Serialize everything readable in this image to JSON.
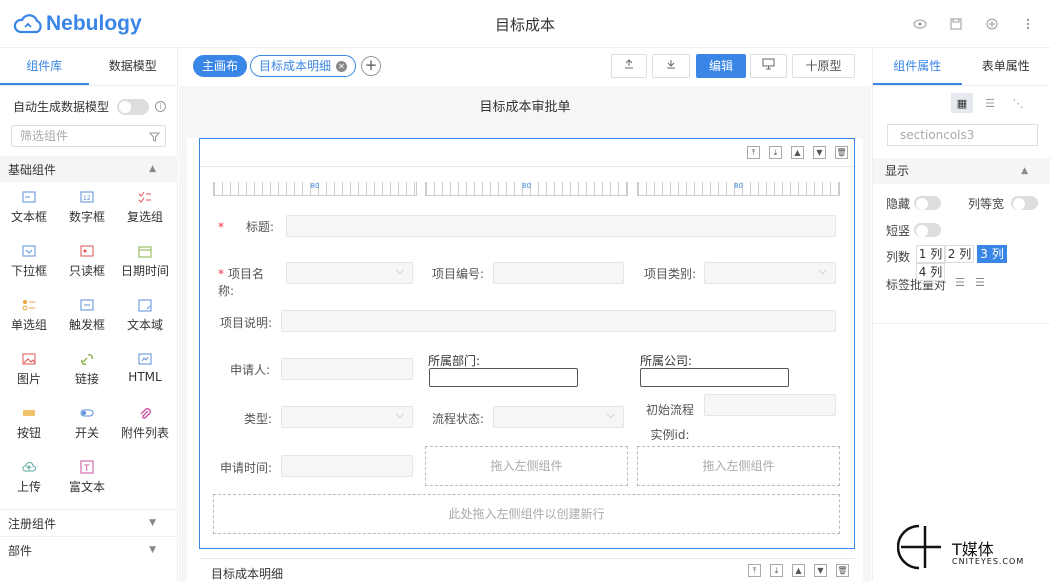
{
  "app": {
    "logo": "Nebulogy",
    "title": "目标成本"
  },
  "left": {
    "tabs": [
      "组件库",
      "数据模型"
    ],
    "auto_model": "自动生成数据模型",
    "filter_placeholder": "筛选组件",
    "basic_section": "基础组件",
    "components": [
      "文本框",
      "数字框",
      "复选组",
      "下拉框",
      "只读框",
      "日期时间",
      "单选组",
      "触发框",
      "文本域",
      "图片",
      "链接",
      "HTML",
      "按钮",
      "开关",
      "附件列表",
      "上传",
      "富文本"
    ],
    "other_sections": [
      "注册组件",
      "部件"
    ]
  },
  "center": {
    "tabs": [
      "主画布",
      "目标成本明细"
    ],
    "edit_label": "编辑",
    "proto_label": "十原型",
    "form_title": "目标成本审批单",
    "ruler_value": "80",
    "fields": {
      "title": "标题:",
      "project_name": "项目名称:",
      "project_no": "项目编号:",
      "project_type": "项目类别:",
      "project_desc": "项目说明:",
      "applicant": "申请人:",
      "department": "所属部门:",
      "company": "所属公司:",
      "type": "类型:",
      "flow_status": "流程状态:",
      "flow_instance": "初始流程实例id:",
      "apply_time": "申请时间:"
    },
    "drop_hint": "拖入左侧组件",
    "new_row_hint": "此处拖入左侧组件以创建新行",
    "next_section": "目标成本明细"
  },
  "right": {
    "tabs": [
      "组件属性",
      "表单属性"
    ],
    "component_id": "sectioncols3",
    "display_section": "显示",
    "hidden": "隐藏",
    "equal_width": "列等宽",
    "short": "短竖",
    "columns_label": "列数",
    "columns": [
      "1 列",
      "2 列",
      "3 列",
      "4 列"
    ],
    "label_align": "标签批量对"
  },
  "watermark": {
    "brand": "T媒体",
    "sub": "CNITEYES.COM"
  },
  "colors": {
    "accent": "#3a86e6"
  }
}
